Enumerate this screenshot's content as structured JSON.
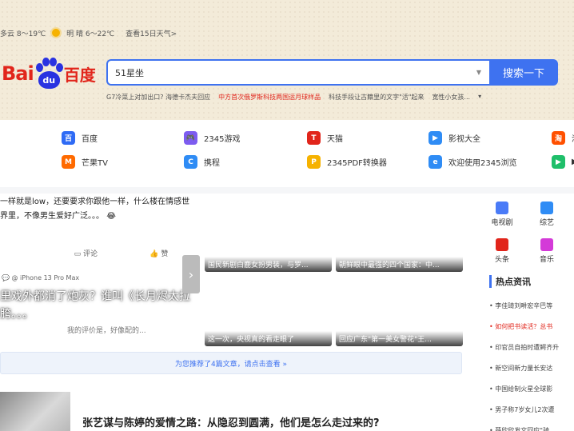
{
  "weather": {
    "today": "多云 8～19℃",
    "tomorrow": "明 晴 6～22℃",
    "forecast_link": "查看15日天气>"
  },
  "logo": {
    "bai": "Bai",
    "du": "du",
    "cn": "百度"
  },
  "search": {
    "value": "51星坐",
    "button": "搜索一下"
  },
  "hotline": [
    {
      "text": "G7冷菜上对加出口? 海德卡杰夫回应",
      "red": false
    },
    {
      "text": "中方首次俄罗斯科技两国运月球样品",
      "red": true
    },
    {
      "text": "科技手段让古籍里的文字\"活\"起来",
      "red": false
    },
    {
      "text": "宽性小女孩...",
      "red": false
    },
    {
      "text": "▾",
      "red": false
    }
  ],
  "sites": [
    {
      "label": "百度",
      "icon": "baidu-paw-icon",
      "color": "#2f6bf5",
      "glyph": "百"
    },
    {
      "label": "2345游戏",
      "icon": "game-controller-icon",
      "color": "#7d5cf0",
      "glyph": "🎮"
    },
    {
      "label": "天猫",
      "icon": "tmall-icon",
      "color": "#e1251b",
      "glyph": "T"
    },
    {
      "label": "影视大全",
      "icon": "play-icon",
      "color": "#2f8cf5",
      "glyph": "▶"
    },
    {
      "label": "淘",
      "icon": "taobao-icon",
      "color": "#ff5000",
      "glyph": "淘"
    },
    {
      "label": "芒果TV",
      "icon": "mango-tv-icon",
      "color": "#ff6a00",
      "glyph": "M"
    },
    {
      "label": "携程",
      "icon": "ctrip-icon",
      "color": "#2f8cf5",
      "glyph": "C"
    },
    {
      "label": "2345PDF转换器",
      "icon": "pdf-icon",
      "color": "#f6b200",
      "glyph": "P"
    },
    {
      "label": "欢迎使用2345浏览",
      "icon": "browser-icon",
      "color": "#2f8cf5",
      "glyph": "e"
    },
    {
      "label": "▶",
      "icon": "video-icon",
      "color": "#1fbf6a",
      "glyph": "▶"
    }
  ],
  "feed": {
    "text": "一样就是low，还要要求你跟他一样，什么楼在情感世界里，不像男生爱好广泛。。。",
    "emoji": "😂",
    "comment": "评论",
    "like": "赞",
    "device_meta": "💬 @ iPhone 13 Pro Max",
    "headline": "里戏外都消了炮灰？谁叫《长月烬太拉胯。。。",
    "evaluation": "我的评价是，好像配的...",
    "more": "对"
  },
  "tiles": [
    {
      "banner": "剧集角色吸粉榜",
      "caption": "国民新剧白鹿女扮男装，与罗...",
      "bg": "linear-gradient(160deg,#2b1b2e,#5a3348 50,#1b1420)"
    },
    {
      "banner": "",
      "caption": "朝鲜眼中最强的四个国家：中...",
      "bg": "linear-gradient(160deg,#6a5a4a,#9a8670 50,#3a2e26)"
    },
    {
      "banner": "",
      "caption": "这一次，央视真的看走眼了",
      "bg": "linear-gradient(160deg,#1a2a6a,#3b4fb0 50,#0e1640)"
    },
    {
      "banner": "",
      "caption": "回应广东\"第一美女警花\"王...",
      "bg": "linear-gradient(160deg,#8a8a8a,#d9d4cf 55,#6e6862)"
    }
  ],
  "rec_bar": "为您推荐了4篇文章，请点击查看 »",
  "article_title": "张艺谋与陈婷的爱情之路：从隐忍到圆满，他们是怎么走过来的?",
  "right_icons": [
    {
      "label": "电视剧",
      "icon": "tv-icon",
      "color": "#4a7bf7"
    },
    {
      "label": "综艺",
      "icon": "mic-icon",
      "color": "#2f8cf5"
    },
    {
      "label": "头条",
      "icon": "headline-icon",
      "color": "#e1251b"
    },
    {
      "label": "音乐",
      "icon": "music-icon",
      "color": "#d43ad8"
    }
  ],
  "hot_news": {
    "title": "热点资讯",
    "items": [
      {
        "text": "李佳琦刘畊宏辛巴等",
        "red": false
      },
      {
        "text": "如何把书读活？总书",
        "red": true
      },
      {
        "text": "印官员自拍时遭鳄齐升",
        "red": false
      },
      {
        "text": "新空间新力量长安达",
        "red": false
      },
      {
        "text": "中国给制火星全球影",
        "red": false
      },
      {
        "text": "男子称7岁女儿2次遭",
        "red": false
      },
      {
        "text": "薛欣欣发文回应\"骑",
        "red": false
      }
    ]
  }
}
